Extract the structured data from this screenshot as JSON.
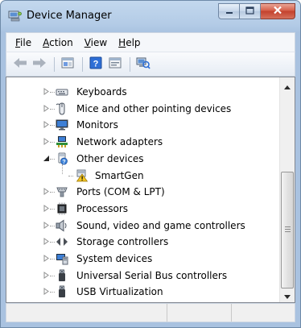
{
  "window": {
    "title": "Device Manager"
  },
  "menu": {
    "items": [
      {
        "label": "File",
        "accel": "F"
      },
      {
        "label": "Action",
        "accel": "A"
      },
      {
        "label": "View",
        "accel": "V"
      },
      {
        "label": "Help",
        "accel": "H"
      }
    ]
  },
  "toolbar": {
    "buttons": [
      "back-arrow-icon",
      "forward-arrow-icon",
      "properties-pane-icon",
      "help-icon",
      "show-hide-console-tree-icon",
      "scan-hardware-changes-icon"
    ]
  },
  "tree": {
    "items": [
      {
        "label": "Keyboards",
        "icon": "keyboard-icon",
        "expanded": false,
        "level": 1
      },
      {
        "label": "Mice and other pointing devices",
        "icon": "mouse-icon",
        "expanded": false,
        "level": 1
      },
      {
        "label": "Monitors",
        "icon": "monitor-icon",
        "expanded": false,
        "level": 1
      },
      {
        "label": "Network adapters",
        "icon": "network-adapter-icon",
        "expanded": false,
        "level": 1
      },
      {
        "label": "Other devices",
        "icon": "unknown-device-icon",
        "expanded": true,
        "level": 1
      },
      {
        "label": "SmartGen",
        "icon": "warning-device-icon",
        "expanded": null,
        "level": 2
      },
      {
        "label": "Ports (COM & LPT)",
        "icon": "port-icon",
        "expanded": false,
        "level": 1
      },
      {
        "label": "Processors",
        "icon": "processor-icon",
        "expanded": false,
        "level": 1
      },
      {
        "label": "Sound, video and game controllers",
        "icon": "speaker-icon",
        "expanded": false,
        "level": 1
      },
      {
        "label": "Storage controllers",
        "icon": "storage-controller-icon",
        "expanded": false,
        "level": 1
      },
      {
        "label": "System devices",
        "icon": "system-device-icon",
        "expanded": false,
        "level": 1
      },
      {
        "label": "Universal Serial Bus controllers",
        "icon": "usb-icon",
        "expanded": false,
        "level": 1
      },
      {
        "label": "USB Virtualization",
        "icon": "usb-icon",
        "expanded": false,
        "level": 1
      }
    ]
  },
  "colors": {
    "title_bar": "#b3cbe6",
    "close_button": "#c3412d"
  }
}
